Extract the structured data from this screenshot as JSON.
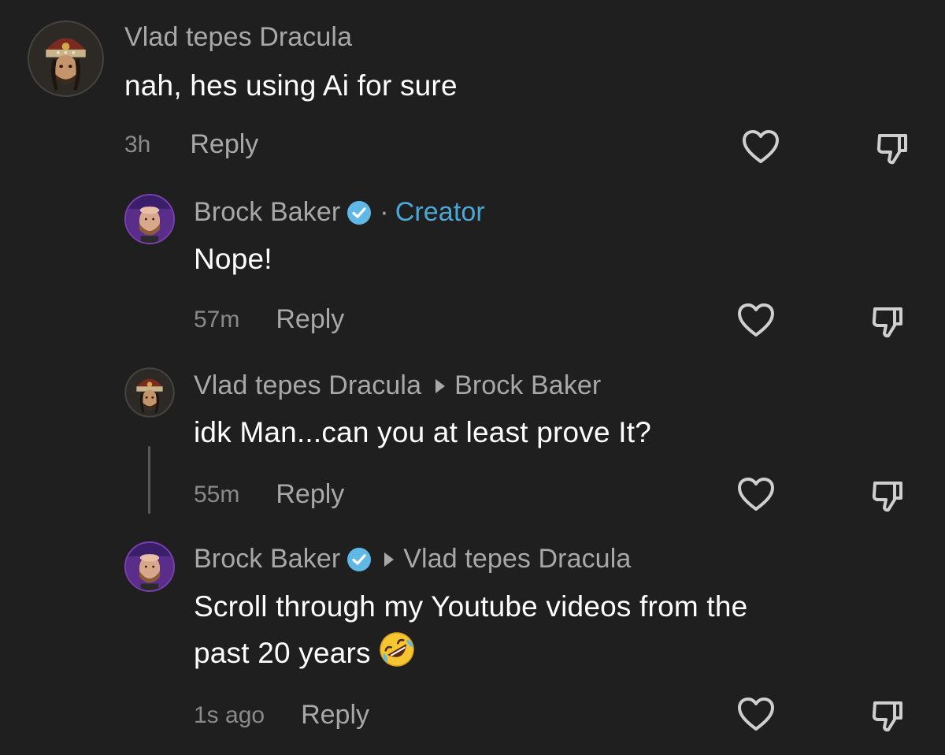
{
  "comments": [
    {
      "username": "Vlad tepes Dracula",
      "text": "nah, hes using Ai for sure",
      "timestamp": "3h",
      "reply_label": "Reply",
      "avatar_icon": "vlad-portrait-avatar"
    },
    {
      "username": "Brock Baker",
      "verified": true,
      "badge_separator": "·",
      "badge": "Creator",
      "text": "Nope!",
      "timestamp": "57m",
      "reply_label": "Reply",
      "avatar_icon": "brock-baker-avatar"
    },
    {
      "username": "Vlad tepes Dracula",
      "replying_to": "Brock Baker",
      "text": "idk Man...can you at least prove It?",
      "timestamp": "55m",
      "reply_label": "Reply",
      "avatar_icon": "vlad-portrait-avatar"
    },
    {
      "username": "Brock Baker",
      "verified": true,
      "replying_to": "Vlad tepes Dracula",
      "text": "Scroll through my Youtube videos from the past 20 years",
      "text_line1": "Scroll through my Youtube videos from the",
      "text_line2": "past 20 years",
      "emoji": "rolling-on-floor-laughing-emoji",
      "timestamp": "1s ago",
      "reply_label": "Reply",
      "avatar_icon": "brock-baker-avatar"
    }
  ],
  "colors": {
    "background": "#1f1f1f",
    "primary_text": "#ffffff",
    "secondary_text": "#a8a8a8",
    "timestamp_text": "#8a8a8a",
    "creator_badge": "#4aa8d8",
    "verified_badge": "#5fb8e6"
  },
  "icons": {
    "like": "heart-outline-icon",
    "dislike": "thumbs-down-outline-icon",
    "verified": "verified-check-icon",
    "reply_to": "caret-right-icon"
  }
}
